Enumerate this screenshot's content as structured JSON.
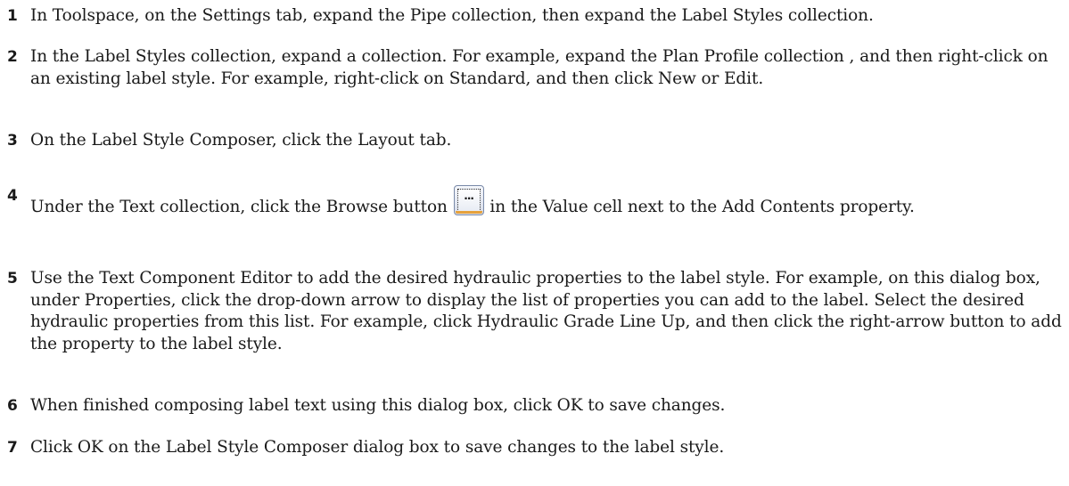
{
  "steps": [
    {
      "number": "1",
      "text": "In Toolspace, on the Settings tab, expand the Pipe collection, then expand the Label Styles collection."
    },
    {
      "number": "2",
      "text": "In the Label Styles collection, expand a collection. For example, expand the Plan Profile collection , and then right-click on an existing label style. For example, right-click on Standard, and then click New or Edit."
    },
    {
      "number": "3",
      "text": "On the Label Style Composer, click the Layout tab."
    },
    {
      "number": "4",
      "text_before": "Under the Text collection, click the Browse button ",
      "text_after": " in the Value cell next to the Add Contents property.",
      "icon": "browse-ellipsis-icon"
    },
    {
      "number": "5",
      "text": "Use the Text Component Editor to add the desired hydraulic properties to the label style. For example, on this dialog box, under Properties, click the drop-down arrow to display the list of properties you can add to the label. Select the desired hydraulic properties from this list. For example, click Hydraulic Grade Line Up, and then click the right-arrow button to add the property to the label style."
    },
    {
      "number": "6",
      "text": "When finished composing label text using this dialog box, click OK to save changes."
    },
    {
      "number": "7",
      "text": "Click OK on the Label Style Composer dialog box to save changes to the label style."
    }
  ]
}
